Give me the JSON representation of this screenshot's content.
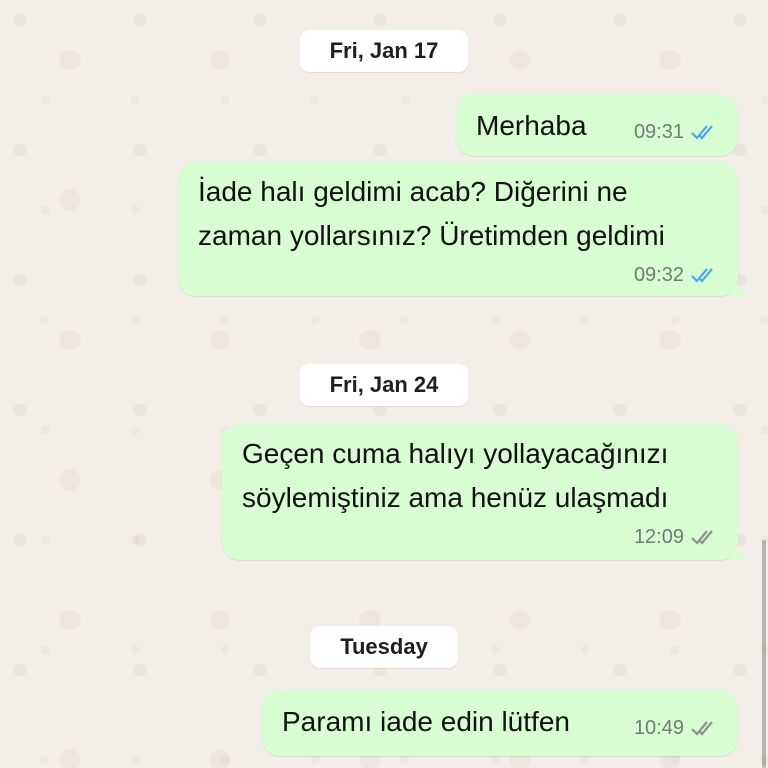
{
  "chat": {
    "dates": {
      "d1": "Fri, Jan 17",
      "d2": "Fri, Jan 24",
      "d3": "Tuesday"
    },
    "messages": [
      {
        "text": "Merhaba",
        "time": "09:31",
        "status": "read",
        "check_color": "#4fa8e8"
      },
      {
        "text": "İade halı geldimi acab? Diğerini ne zaman yollarsınız? Üretimden geldimi",
        "time": "09:32",
        "status": "read",
        "check_color": "#4fa8e8"
      },
      {
        "text": "Geçen cuma halıyı yollayacağınızı söylemiştiniz ama henüz ulaşmadı",
        "time": "12:09",
        "status": "delivered",
        "check_color": "#8a938d"
      },
      {
        "text": "Paramı iade edin lütfen",
        "time": "10:49",
        "status": "delivered",
        "check_color": "#8a938d"
      }
    ]
  },
  "colors": {
    "outgoing_bubble": "#d9fdd3",
    "background": "#f3efe8"
  }
}
